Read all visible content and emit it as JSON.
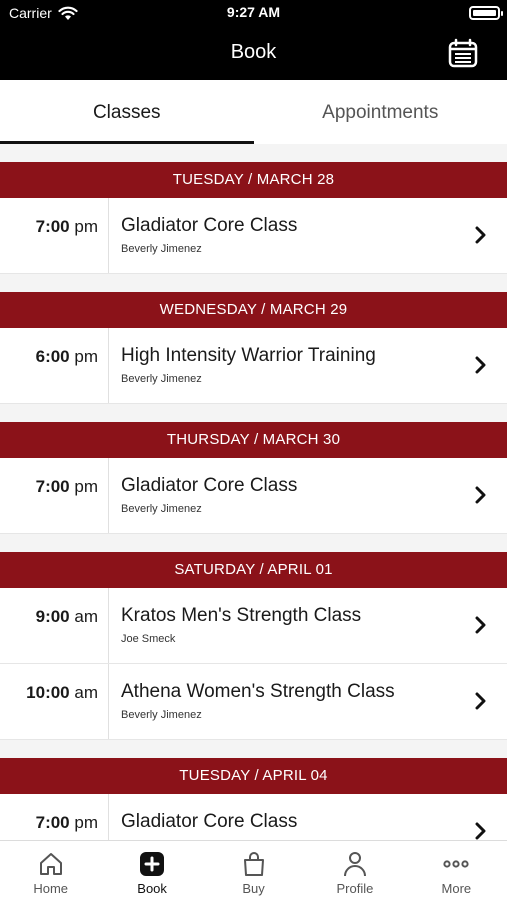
{
  "status_bar": {
    "carrier": "Carrier",
    "time": "9:27 AM"
  },
  "nav": {
    "title": "Book",
    "calendar_icon": "calendar-icon"
  },
  "tabs": [
    {
      "label": "Classes",
      "active": true
    },
    {
      "label": "Appointments",
      "active": false
    }
  ],
  "schedule": [
    {
      "day": "TUESDAY / MARCH 28",
      "classes": [
        {
          "time": "7:00",
          "meridiem": "pm",
          "name": "Gladiator Core Class",
          "instructor": "Beverly Jimenez"
        }
      ]
    },
    {
      "day": "WEDNESDAY / MARCH 29",
      "classes": [
        {
          "time": "6:00",
          "meridiem": "pm",
          "name": "High Intensity Warrior Training",
          "instructor": "Beverly Jimenez"
        }
      ]
    },
    {
      "day": "THURSDAY / MARCH 30",
      "classes": [
        {
          "time": "7:00",
          "meridiem": "pm",
          "name": "Gladiator Core Class",
          "instructor": "Beverly Jimenez"
        }
      ]
    },
    {
      "day": "SATURDAY / APRIL 01",
      "classes": [
        {
          "time": "9:00",
          "meridiem": "am",
          "name": "Kratos Men's Strength Class",
          "instructor": "Joe Smeck"
        },
        {
          "time": "10:00",
          "meridiem": "am",
          "name": "Athena Women's Strength Class",
          "instructor": "Beverly Jimenez"
        }
      ]
    },
    {
      "day": "TUESDAY / APRIL 04",
      "classes": [
        {
          "time": "7:00",
          "meridiem": "pm",
          "name": "Gladiator Core Class",
          "instructor": ""
        }
      ]
    }
  ],
  "tab_bar": [
    {
      "label": "Home",
      "icon": "home-icon",
      "active": false
    },
    {
      "label": "Book",
      "icon": "plus-square-icon",
      "active": true
    },
    {
      "label": "Buy",
      "icon": "shopping-bag-icon",
      "active": false
    },
    {
      "label": "Profile",
      "icon": "person-icon",
      "active": false
    },
    {
      "label": "More",
      "icon": "ellipsis-icon",
      "active": false
    }
  ],
  "colors": {
    "accent": "#8b1219",
    "header_bg": "#000000"
  }
}
